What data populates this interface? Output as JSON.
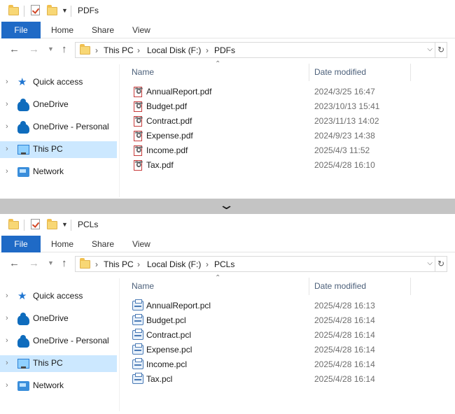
{
  "ribbon": {
    "file": "File",
    "home": "Home",
    "share": "Share",
    "view": "View"
  },
  "nav": {
    "items": [
      "Quick access",
      "OneDrive",
      "OneDrive - Personal",
      "This PC",
      "Network"
    ],
    "selected": "This PC"
  },
  "columns": {
    "name": "Name",
    "date": "Date modified"
  },
  "colors": {
    "accent": "#1f6ac6",
    "selection": "#cce8ff"
  },
  "top": {
    "title": "PDFs",
    "breadcrumb": [
      "This PC",
      "Local Disk (F:)",
      "PDFs"
    ],
    "files": [
      {
        "name": "AnnualReport.pdf",
        "date": "2024/3/25 16:47",
        "icon": "pdf-file-icon"
      },
      {
        "name": "Budget.pdf",
        "date": "2023/10/13 15:41",
        "icon": "pdf-file-icon"
      },
      {
        "name": "Contract.pdf",
        "date": "2023/11/13 14:02",
        "icon": "pdf-file-icon"
      },
      {
        "name": "Expense.pdf",
        "date": "2024/9/23 14:38",
        "icon": "pdf-file-icon"
      },
      {
        "name": "Income.pdf",
        "date": "2025/4/3 11:52",
        "icon": "pdf-file-icon"
      },
      {
        "name": "Tax.pdf",
        "date": "2025/4/28 16:10",
        "icon": "pdf-file-icon"
      }
    ]
  },
  "bottom": {
    "title": "PCLs",
    "breadcrumb": [
      "This PC",
      "Local Disk (F:)",
      "PCLs"
    ],
    "files": [
      {
        "name": "AnnualReport.pcl",
        "date": "2025/4/28 16:13",
        "icon": "printer-file-icon"
      },
      {
        "name": "Budget.pcl",
        "date": "2025/4/28 16:14",
        "icon": "printer-file-icon"
      },
      {
        "name": "Contract.pcl",
        "date": "2025/4/28 16:14",
        "icon": "printer-file-icon"
      },
      {
        "name": "Expense.pcl",
        "date": "2025/4/28 16:14",
        "icon": "printer-file-icon"
      },
      {
        "name": "Income.pcl",
        "date": "2025/4/28 16:14",
        "icon": "printer-file-icon"
      },
      {
        "name": "Tax.pcl",
        "date": "2025/4/28 16:14",
        "icon": "printer-file-icon"
      }
    ]
  }
}
